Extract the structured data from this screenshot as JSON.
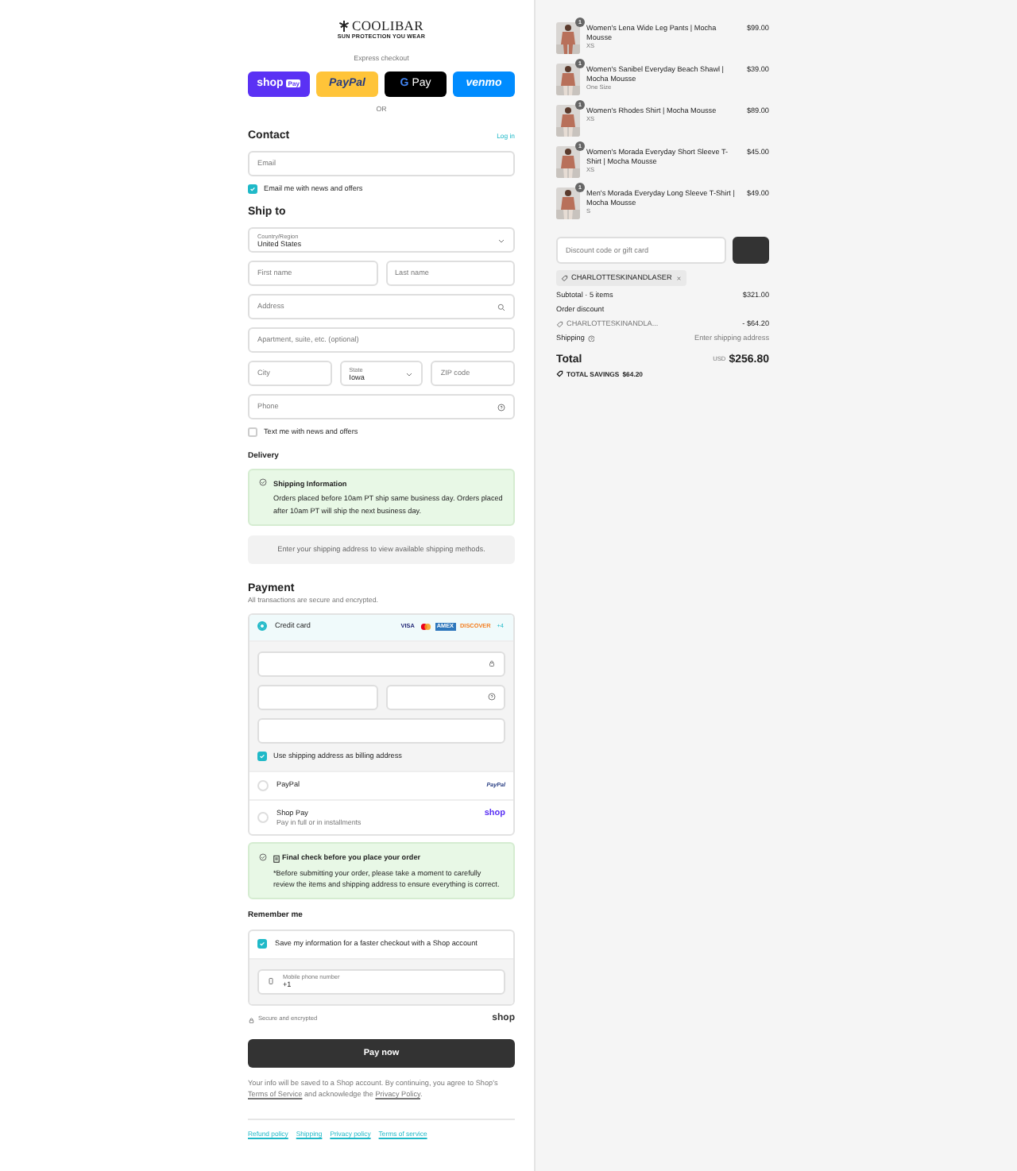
{
  "logo": {
    "name": "COOLIBAR",
    "tagline": "SUN PROTECTION YOU WEAR"
  },
  "express": {
    "title": "Express checkout",
    "buttons": [
      {
        "kind": "shop",
        "label": "shop",
        "badge": "Pay"
      },
      {
        "kind": "paypal",
        "label": "PayPal"
      },
      {
        "kind": "gpay",
        "label": "Pay",
        "mark": "G"
      },
      {
        "kind": "venmo",
        "label": "venmo"
      }
    ],
    "divider": "OR"
  },
  "contact": {
    "title": "Contact",
    "link": "Log in",
    "email": {
      "placeholder": "Email"
    },
    "newsletter": {
      "label": "Email me with news and offers",
      "checked": true
    }
  },
  "ship_to": {
    "title": "Ship to",
    "rows": [
      [
        {
          "kind": "select",
          "label": "Country/Region",
          "value": "United States"
        }
      ],
      [
        {
          "kind": "text",
          "placeholder": "First name"
        },
        {
          "kind": "text",
          "placeholder": "Last name"
        }
      ],
      [
        {
          "kind": "search",
          "placeholder": "Address"
        }
      ],
      [
        {
          "kind": "text",
          "placeholder": "Apartment, suite, etc. (optional)"
        }
      ],
      [
        {
          "kind": "text",
          "placeholder": "City"
        },
        {
          "kind": "select",
          "label": "State",
          "value": "Iowa"
        },
        {
          "kind": "text",
          "placeholder": "ZIP code"
        }
      ],
      [
        {
          "kind": "help",
          "placeholder": "Phone"
        }
      ]
    ],
    "sms": {
      "label": "Text me with news and offers",
      "checked": false
    }
  },
  "delivery": {
    "title": "Delivery",
    "notice": {
      "title": "Shipping Information",
      "text": "Orders placed before 10am PT ship same business day. Orders placed after 10am PT will ship the next business day."
    },
    "message": "Enter your shipping address to view available shipping methods."
  },
  "payment": {
    "title": "Payment",
    "subtitle": "All transactions are secure and encrypted.",
    "methods": [
      {
        "kind": "card",
        "label": "Credit card",
        "selected": true,
        "brands": [
          {
            "kind": "visa",
            "label": "VISA"
          },
          {
            "kind": "mastercard"
          },
          {
            "kind": "amex",
            "label": "AMEX"
          },
          {
            "kind": "discover",
            "label": "DISCOVER"
          },
          {
            "kind": "more",
            "label": "+4"
          }
        ],
        "billing": {
          "label": "Use shipping address as billing address",
          "checked": true
        }
      },
      {
        "kind": "paypal",
        "label": "PayPal",
        "selected": false,
        "logo": "PayPal"
      },
      {
        "kind": "shop",
        "label": "Shop Pay",
        "sublabel": "Pay in full or in installments",
        "selected": false,
        "logo": "shop"
      }
    ]
  },
  "final_check": {
    "title": "Final check before you place your order",
    "text": "*Before submitting your order, please take a moment to carefully review the items and shipping address to ensure everything is correct."
  },
  "remember": {
    "title": "Remember me",
    "save": {
      "label": "Save my information for a faster checkout with a Shop account",
      "checked": true
    },
    "phone": {
      "label": "Mobile phone number",
      "value": "+1"
    },
    "secure": "Secure and encrypted",
    "brand": "shop"
  },
  "pay_button": "Pay now",
  "legal": [
    {
      "text": "Your info will be saved to a Shop account. By continuing, you agree to Shop's ",
      "link": false
    },
    {
      "text": "Terms of Service",
      "link": true
    },
    {
      "text": " and acknowledge the ",
      "link": false
    },
    {
      "text": "Privacy Policy",
      "link": true
    },
    {
      "text": ".",
      "link": false
    }
  ],
  "footer_links": [
    "Refund policy",
    "Shipping",
    "Privacy policy",
    "Terms of service"
  ],
  "summary": {
    "items": [
      {
        "name": "Women's Lena Wide Leg Pants | Mocha Mousse",
        "variant": "XS",
        "price": "$99.00",
        "quantity": "1"
      },
      {
        "name": "Women's Sanibel Everyday Beach Shawl | Mocha Mousse",
        "variant": "One Size",
        "price": "$39.00",
        "quantity": "1"
      },
      {
        "name": "Women's Rhodes Shirt | Mocha Mousse",
        "variant": "XS",
        "price": "$89.00",
        "quantity": "1"
      },
      {
        "name": "Women's Morada Everyday Short Sleeve T-Shirt | Mocha Mousse",
        "variant": "XS",
        "price": "$45.00",
        "quantity": "1"
      },
      {
        "name": "Men's Morada Everyday Long Sleeve T-Shirt | Mocha Mousse",
        "variant": "S",
        "price": "$49.00",
        "quantity": "1"
      }
    ],
    "discount": {
      "placeholder": "Discount code or gift card"
    },
    "applied_code": "CHARLOTTESKINANDLASER",
    "subtotal": {
      "label": "Subtotal · 5 items",
      "value": "$321.00"
    },
    "order_discount": {
      "label": "Order discount",
      "code": "CHARLOTTESKINANDLA...",
      "value": "- $64.20"
    },
    "shipping": {
      "label": "Shipping",
      "value": "Enter shipping address"
    },
    "total": {
      "label": "Total",
      "currency": "USD",
      "value": "$256.80"
    },
    "savings": {
      "label": "TOTAL SAVINGS",
      "value": "$64.20"
    }
  }
}
